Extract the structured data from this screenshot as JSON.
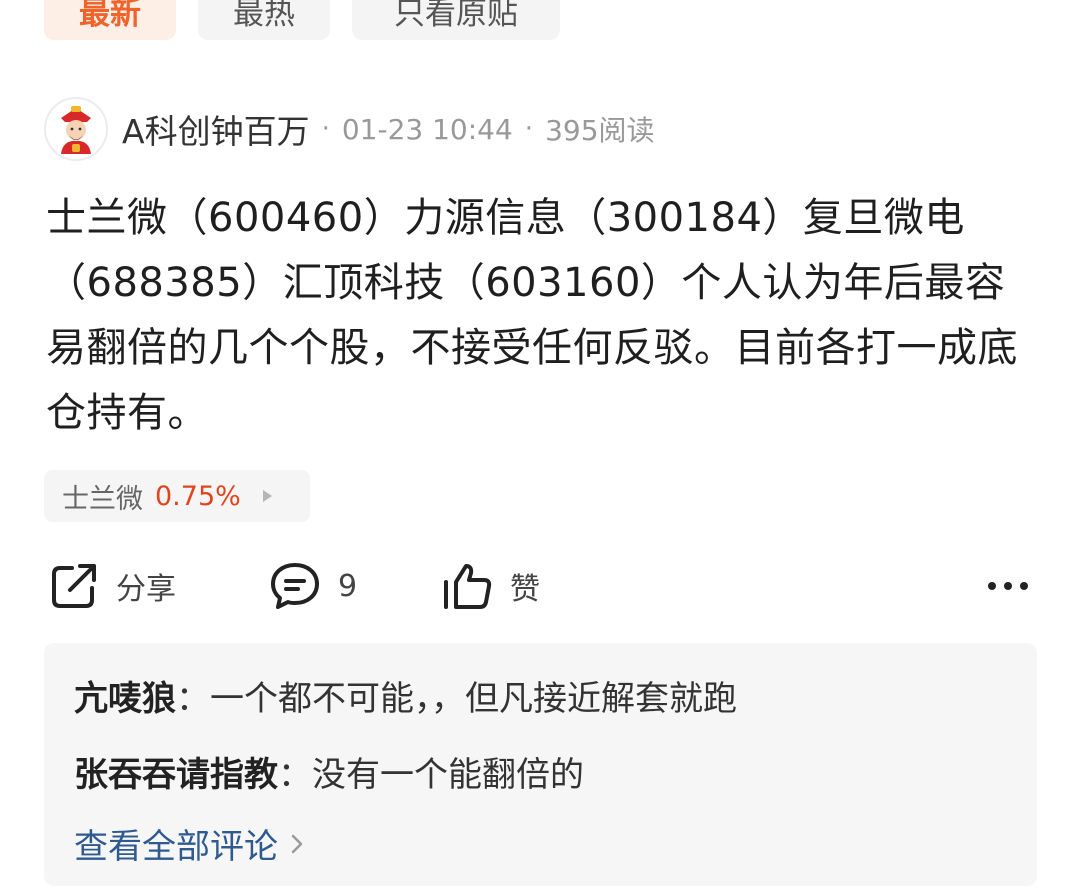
{
  "tabs": [
    {
      "label": "最新",
      "active": true
    },
    {
      "label": "最热",
      "active": false
    },
    {
      "label": "只看原贴",
      "active": false
    }
  ],
  "post": {
    "author": "A科创钟百万",
    "time": "01-23 10:44",
    "reads": "395阅读",
    "content": "士兰微（600460）力源信息（300184）复旦微电（688385）汇顶科技（603160）个人认为年后最容易翻倍的几个个股，不接受任何反驳。目前各打一成底仓持有。"
  },
  "stock_tag": {
    "name": "士兰微",
    "change": "0.75%",
    "change_color": "#e0461e"
  },
  "actions": {
    "share_label": "分享",
    "comment_count": "9",
    "like_label": "赞"
  },
  "comments": [
    {
      "user": "亢唛狼",
      "sep": "：",
      "text": "一个都不可能，，但凡接近解套就跑"
    },
    {
      "user": "张吞吞请指教",
      "sep": "：",
      "text": "没有一个能翻倍的"
    }
  ],
  "view_all_label": "查看全部评论",
  "colors": {
    "accent": "#f0642c",
    "link": "#2f5a8f",
    "up": "#e0461e"
  }
}
